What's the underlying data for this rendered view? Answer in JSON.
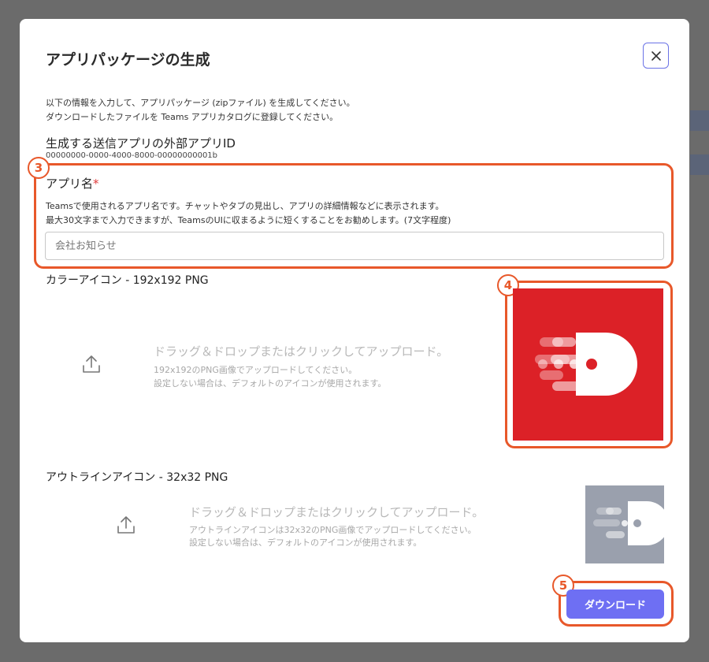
{
  "modal": {
    "title": "アプリパッケージの生成",
    "description_line1": "以下の情報を入力して、アプリパッケージ (zipファイル) を生成してください。",
    "description_line2": "ダウンロードしたファイルを Teams アプリカタログに登録してください。"
  },
  "external_id": {
    "label": "生成する送信アプリの外部アプリID",
    "value": "00000000-0000-4000-8000-00000000001b"
  },
  "app_name": {
    "label": "アプリ名",
    "required_mark": "*",
    "help_line1": "Teamsで使用されるアプリ名です。チャットやタブの見出し、アプリの詳細情報などに表示されます。",
    "help_line2": "最大30文字まで入力できますが、TeamsのUIに収まるように短くすることをお勧めします。(7文字程度)",
    "placeholder": "会社お知らせ"
  },
  "color_icon": {
    "label": "カラーアイコン - 192x192 PNG",
    "upload_main": "ドラッグ＆ドロップまたはクリックしてアップロード。",
    "upload_sub1": "192x192のPNG画像でアップロードしてください。",
    "upload_sub2": "設定しない場合は、デフォルトのアイコンが使用されます。",
    "bg_color": "#dc2127"
  },
  "outline_icon": {
    "label": "アウトラインアイコン - 32x32 PNG",
    "upload_main": "ドラッグ＆ドロップまたはクリックしてアップロード。",
    "upload_sub1": "アウトラインアイコンは32x32のPNG画像でアップロードしてください。",
    "upload_sub2": "設定しない場合は、デフォルトのアイコンが使用されます。",
    "bg_color": "#9aa0ad"
  },
  "download_label": "ダウンロード",
  "badges": {
    "app_name": "3",
    "color_icon": "4",
    "download": "5"
  },
  "colors": {
    "highlight": "#e8582a",
    "accent": "#6e6ff3"
  }
}
